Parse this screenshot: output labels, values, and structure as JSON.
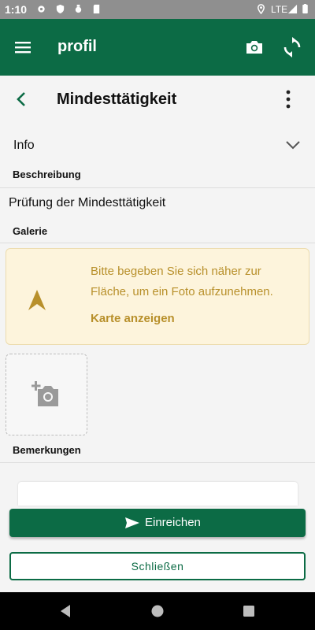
{
  "status_bar": {
    "time": "1:10",
    "network": "LTE"
  },
  "app_bar": {
    "title": "profil",
    "icons": [
      "menu-icon",
      "camera-icon",
      "sync-icon"
    ],
    "color": "#0c6b45"
  },
  "page": {
    "title": "Mindesttätigkeit"
  },
  "info": {
    "label": "Info"
  },
  "description": {
    "heading": "Beschreibung",
    "text": "Prüfung der Mindesttätigkeit"
  },
  "gallery": {
    "heading": "Galerie",
    "banner_message": "Bitte begeben Sie sich näher zur Fläche, um ein Foto aufzunehmen.",
    "banner_link": "Karte anzeigen",
    "banner_color": "#b8902b"
  },
  "remarks": {
    "heading": "Bemerkungen",
    "value": ""
  },
  "actions": {
    "submit_label": "Einreichen",
    "close_label": "Schließen"
  }
}
